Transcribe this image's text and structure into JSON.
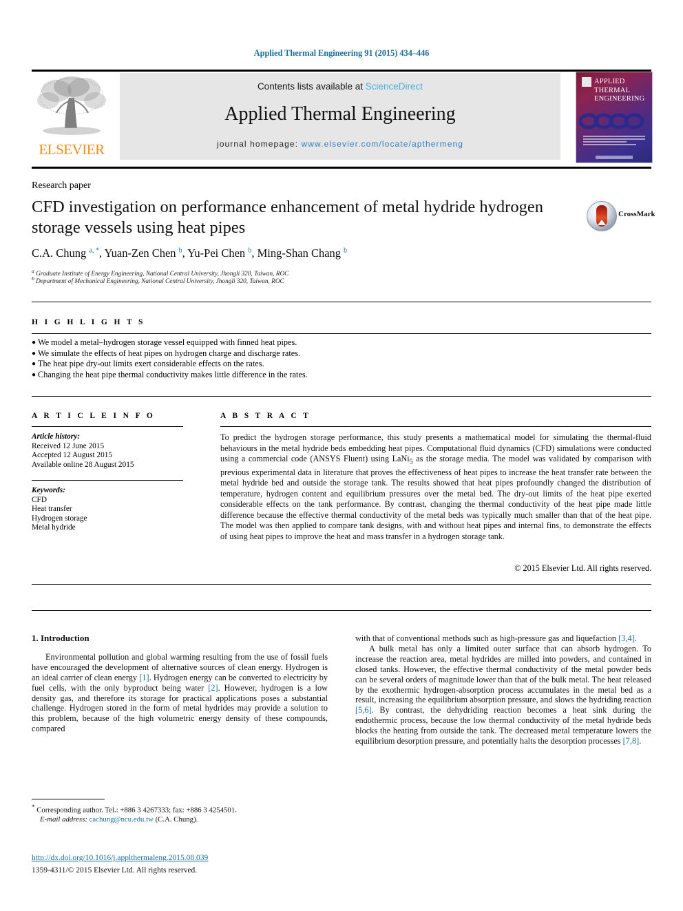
{
  "running_head": "Applied Thermal Engineering 91 (2015) 434–446",
  "masthead": {
    "publisher_name": "ELSEVIER",
    "contents_prefix": "Contents lists available at ",
    "contents_link": "ScienceDirect",
    "journal_title": "Applied Thermal Engineering",
    "homepage_prefix": "journal homepage: ",
    "homepage_url": "www.elsevier.com/locate/apthermeng",
    "cover_title": "APPLIED THERMAL ENGINEERING"
  },
  "article": {
    "type": "Research paper",
    "title": "CFD investigation on performance enhancement of metal hydride hydrogen storage vessels using heat pipes",
    "crossmark_label": "CrossMark",
    "authors_html": "C.A. Chung <sup>a, *</sup>, Yuan-Zen Chen <sup>b</sup>, Yu-Pei Chen <sup>b</sup>, Ming-Shan Chang <sup>b</sup>",
    "affiliation_a": "Graduate Institute of Energy Engineering, National Central University, Jhongli 320, Taiwan, ROC",
    "affiliation_b": "Department of Mechanical Engineering, National Central University, Jhongli 320, Taiwan, ROC"
  },
  "highlights": {
    "label": "H I G H L I G H T S",
    "items": [
      "We model a metal–hydrogen storage vessel equipped with finned heat pipes.",
      "We simulate the effects of heat pipes on hydrogen charge and discharge rates.",
      "The heat pipe dry-out limits exert considerable effects on the rates.",
      "Changing the heat pipe thermal conductivity makes little difference in the rates."
    ]
  },
  "article_info": {
    "label": "A R T I C L E   I N F O",
    "history_label": "Article history:",
    "history": [
      "Received 12 June 2015",
      "Accepted 12 August 2015",
      "Available online 28 August 2015"
    ],
    "keywords_label": "Keywords:",
    "keywords": [
      "CFD",
      "Heat transfer",
      "Hydrogen storage",
      "Metal hydride"
    ]
  },
  "abstract": {
    "label": "A B S T R A C T",
    "text": "To predict the hydrogen storage performance, this study presents a mathematical model for simulating the thermal-fluid behaviours in the metal hydride beds embedding heat pipes. Computational fluid dynamics (CFD) simulations were conducted using a commercial code (ANSYS Fluent) using LaNi5 as the storage media. The model was validated by comparison with previous experimental data in literature that proves the effectiveness of heat pipes to increase the heat transfer rate between the metal hydride bed and outside the storage tank. The results showed that heat pipes profoundly changed the distribution of temperature, hydrogen content and equilibrium pressures over the metal bed. The dry-out limits of the heat pipe exerted considerable effects on the tank performance. By contrast, changing the thermal conductivity of the heat pipe made little difference because the effective thermal conductivity of the metal beds was typically much smaller than that of the heat pipe. The model was then applied to compare tank designs, with and without heat pipes and internal fins, to demonstrate the effects of using heat pipes to improve the heat and mass transfer in a hydrogen storage tank.",
    "copyright": "© 2015 Elsevier Ltd. All rights reserved."
  },
  "body": {
    "section_number_title": "1.  Introduction",
    "left_paragraph_1": "Environmental pollution and global warming resulting from the use of fossil fuels have encouraged the development of alternative sources of clean energy. Hydrogen is an ideal carrier of clean energy [1]. Hydrogen energy can be converted to electricity by fuel cells, with the only byproduct being water [2]. However, hydrogen is a low density gas, and therefore its storage for practical applications poses a substantial challenge. Hydrogen stored in the form of metal hydrides may provide a solution to this problem, because of the high volumetric energy density of these compounds, compared",
    "right_paragraph_1_cont": "with that of conventional methods such as high-pressure gas and liquefaction [3,4].",
    "right_paragraph_2": "A bulk metal has only a limited outer surface that can absorb hydrogen. To increase the reaction area, metal hydrides are milled into powders, and contained in closed tanks. However, the effective thermal conductivity of the metal powder beds can be several orders of magnitude lower than that of the bulk metal. The heat released by the exothermic hydrogen-absorption process accumulates in the metal bed as a result, increasing the equilibrium absorption pressure, and slows the hydriding reaction [5,6]. By contrast, the dehydriding reaction becomes a heat sink during the endothermic process, because the low thermal conductivity of the metal hydride beds blocks the heating from outside the tank. The decreased metal temperature lowers the equilibrium desorption pressure, and potentially halts the desorption processes [7,8]."
  },
  "footer": {
    "corresponding": "Corresponding author. Tel.: +886 3 4267333; fax: +886 3 4254501.",
    "email_label": "E-mail address:",
    "email": "cachung@ncu.edu.tw",
    "email_owner": "(C.A. Chung).",
    "doi": "http://dx.doi.org/10.1016/j.applthermaleng.2015.08.039",
    "issn_line": "1359-4311/© 2015 Elsevier Ltd. All rights reserved."
  },
  "colors": {
    "link": "#1a6ea0",
    "sciencedirect": "#4aaee0",
    "elsevier_orange": "#f08c1e",
    "banner_bg": "#e6e6e6"
  }
}
